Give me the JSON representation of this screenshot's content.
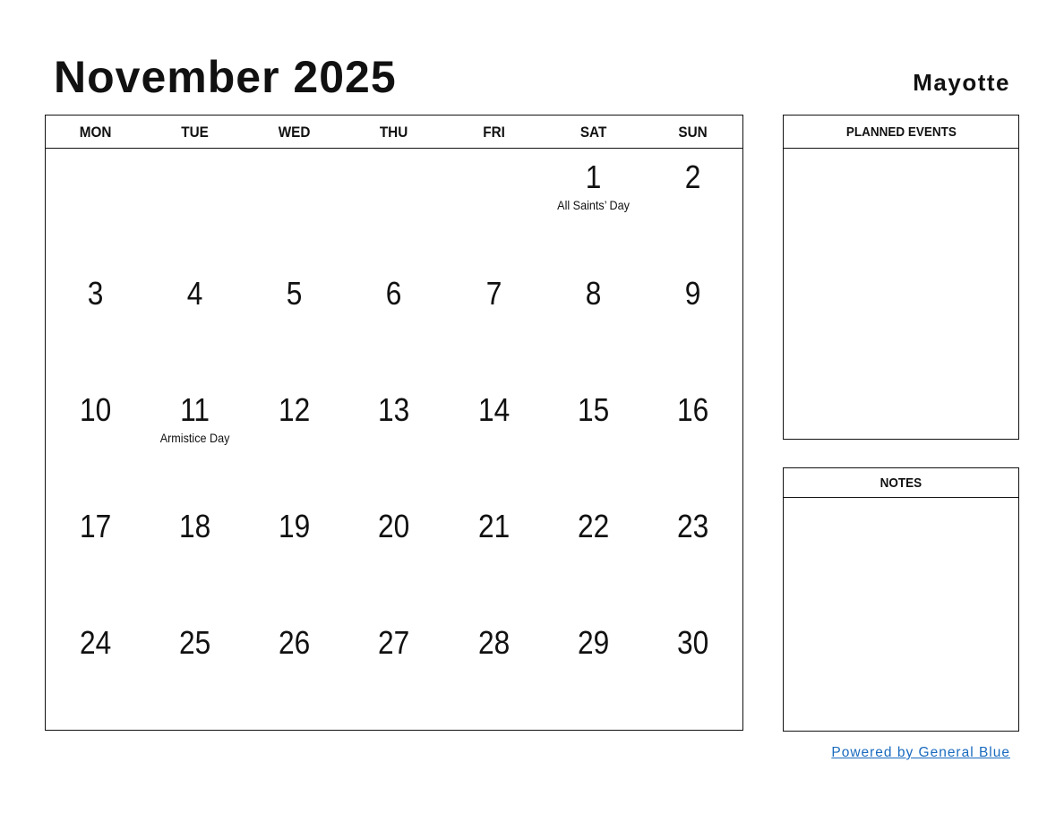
{
  "header": {
    "title": "November 2025",
    "country": "Mayotte"
  },
  "calendar": {
    "weekdays": [
      "MON",
      "TUE",
      "WED",
      "THU",
      "FRI",
      "SAT",
      "SUN"
    ],
    "weeks": [
      [
        {
          "day": ""
        },
        {
          "day": ""
        },
        {
          "day": ""
        },
        {
          "day": ""
        },
        {
          "day": ""
        },
        {
          "day": "1",
          "holiday": "All Saints’ Day"
        },
        {
          "day": "2"
        }
      ],
      [
        {
          "day": "3"
        },
        {
          "day": "4"
        },
        {
          "day": "5"
        },
        {
          "day": "6"
        },
        {
          "day": "7"
        },
        {
          "day": "8"
        },
        {
          "day": "9"
        }
      ],
      [
        {
          "day": "10"
        },
        {
          "day": "11",
          "holiday": "Armistice Day"
        },
        {
          "day": "12"
        },
        {
          "day": "13"
        },
        {
          "day": "14"
        },
        {
          "day": "15"
        },
        {
          "day": "16"
        }
      ],
      [
        {
          "day": "17"
        },
        {
          "day": "18"
        },
        {
          "day": "19"
        },
        {
          "day": "20"
        },
        {
          "day": "21"
        },
        {
          "day": "22"
        },
        {
          "day": "23"
        }
      ],
      [
        {
          "day": "24"
        },
        {
          "day": "25"
        },
        {
          "day": "26"
        },
        {
          "day": "27"
        },
        {
          "day": "28"
        },
        {
          "day": "29"
        },
        {
          "day": "30"
        }
      ]
    ]
  },
  "panels": {
    "events_title": "PLANNED EVENTS",
    "notes_title": "NOTES"
  },
  "footer": {
    "link_text": "Powered by General Blue",
    "link_color": "#1a6bbf"
  }
}
